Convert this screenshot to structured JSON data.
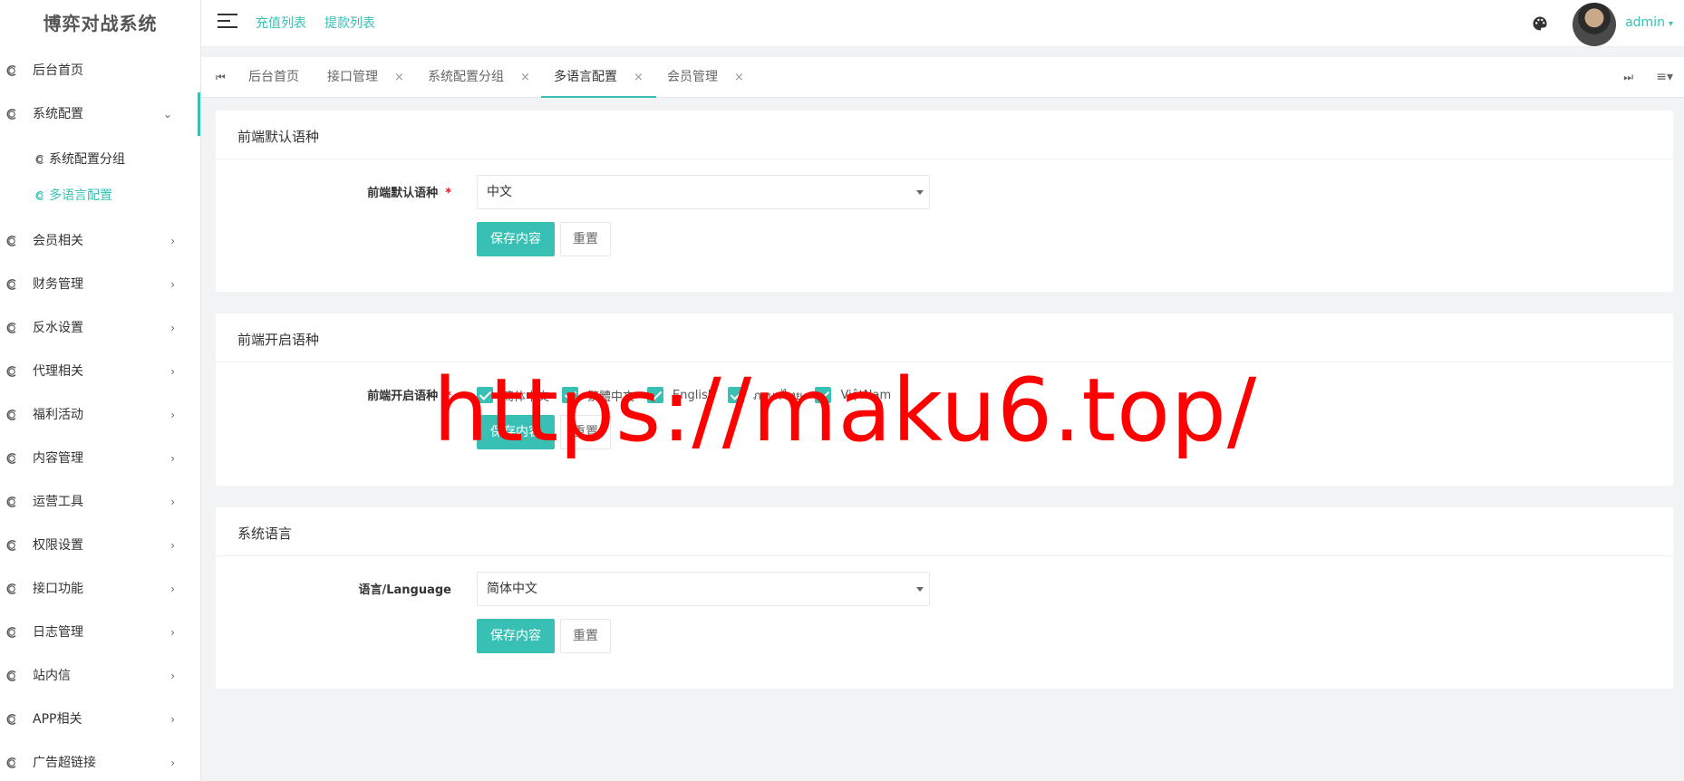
{
  "sidebar": {
    "logo": "博弈对战系统",
    "items": [
      {
        "label": "后台首页"
      },
      {
        "label": "系统配置",
        "open": true,
        "children": [
          {
            "label": "系统配置分组"
          },
          {
            "label": "多语言配置",
            "active": true
          }
        ]
      },
      {
        "label": "会员相关"
      },
      {
        "label": "财务管理"
      },
      {
        "label": "反水设置"
      },
      {
        "label": "代理相关"
      },
      {
        "label": "福利活动"
      },
      {
        "label": "内容管理"
      },
      {
        "label": "运营工具"
      },
      {
        "label": "权限设置"
      },
      {
        "label": "接口功能"
      },
      {
        "label": "日志管理"
      },
      {
        "label": "站内信"
      },
      {
        "label": "APP相关"
      },
      {
        "label": "广告超链接"
      }
    ]
  },
  "header": {
    "links": [
      "充值列表",
      "提款列表"
    ],
    "user": "admin"
  },
  "tabs": [
    {
      "label": "后台首页",
      "closable": false
    },
    {
      "label": "接口管理",
      "closable": true
    },
    {
      "label": "系统配置分组",
      "closable": true
    },
    {
      "label": "多语言配置",
      "closable": true,
      "active": true
    },
    {
      "label": "会员管理",
      "closable": true
    }
  ],
  "tab_close_glyph": "×",
  "sections": {
    "default_lang": {
      "title": "前端默认语种",
      "label": "前端默认语种",
      "value": "中文",
      "save": "保存内容",
      "reset": "重置"
    },
    "enabled_lang": {
      "title": "前端开启语种",
      "label": "前端开启语种",
      "options": [
        "简体中文",
        "繁體中文",
        "English",
        "ภาษาไทย",
        "ViệtNam"
      ],
      "save": "保存内容",
      "reset": "重置"
    },
    "system_lang": {
      "title": "系统语言",
      "label": "语言/Language",
      "value": "简体中文",
      "save": "保存内容",
      "reset": "重置"
    }
  },
  "required_mark": "*",
  "watermark": "https://maku6.top/",
  "colors": {
    "accent": "#38c0b5",
    "required": "#e8162c",
    "watermark": "#ff0000"
  }
}
